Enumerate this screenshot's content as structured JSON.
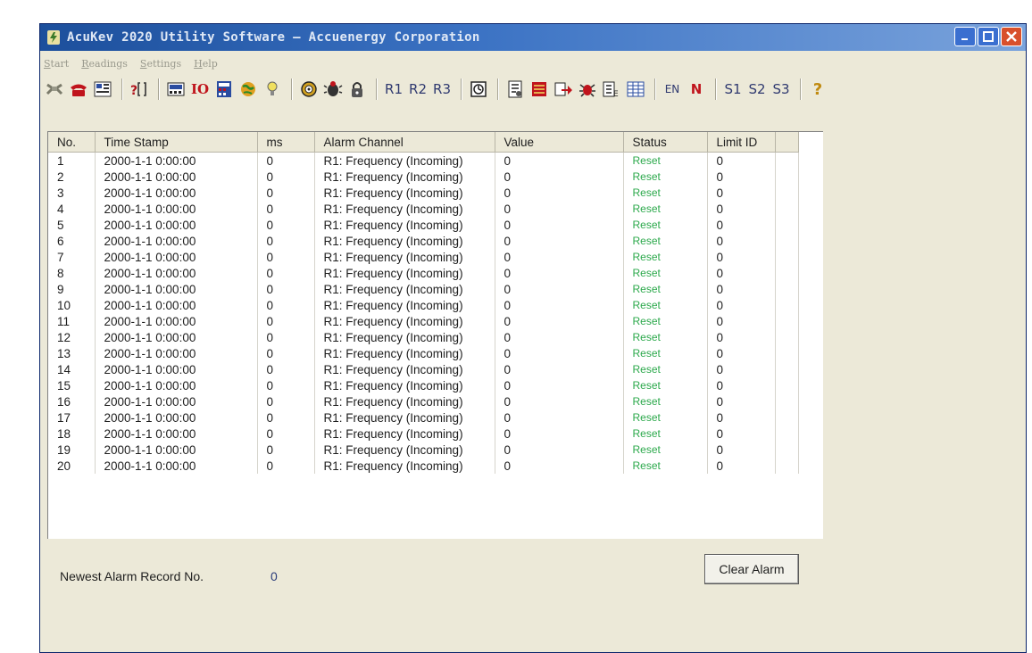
{
  "window": {
    "title": "AcuKev 2020 Utility Software — Accuenergy Corporation",
    "controls": [
      "minimize",
      "maximize",
      "close"
    ]
  },
  "menu": [
    {
      "label": "Start"
    },
    {
      "label": "Readings"
    },
    {
      "label": "Settings"
    },
    {
      "label": "Help"
    }
  ],
  "toolbar": {
    "text_buttons": {
      "r1": "R1",
      "r2": "R2",
      "r3": "R3",
      "en": "EN",
      "n": "N",
      "s1": "S1",
      "s2": "S2",
      "s3": "S3",
      "help": "?",
      "io": "IO"
    },
    "icons": [
      "connect-icon",
      "phone-icon",
      "device-list-icon",
      "query-icon",
      "meter-icon",
      "io-icon",
      "calculator-icon",
      "globe-icon",
      "light-bulb-icon",
      "disc-icon",
      "alarm-bug-icon",
      "lock-icon",
      "r1-icon",
      "r2-icon",
      "r3-icon",
      "timer-icon",
      "record-icon",
      "book-icon",
      "export-icon",
      "bug-icon",
      "eb-icon",
      "grid-icon",
      "en-icon",
      "n-icon",
      "s1-icon",
      "s2-icon",
      "s3-icon",
      "help-icon"
    ]
  },
  "table": {
    "columns": [
      "No.",
      "Time Stamp",
      "ms",
      "Alarm Channel",
      "Value",
      "Status",
      "Limit ID"
    ],
    "rows": [
      [
        "1",
        "2000-1-1 0:00:00",
        "0",
        "R1: Frequency (Incoming)",
        "0",
        "Reset",
        "0"
      ],
      [
        "2",
        "2000-1-1 0:00:00",
        "0",
        "R1: Frequency (Incoming)",
        "0",
        "Reset",
        "0"
      ],
      [
        "3",
        "2000-1-1 0:00:00",
        "0",
        "R1: Frequency (Incoming)",
        "0",
        "Reset",
        "0"
      ],
      [
        "4",
        "2000-1-1 0:00:00",
        "0",
        "R1: Frequency (Incoming)",
        "0",
        "Reset",
        "0"
      ],
      [
        "5",
        "2000-1-1 0:00:00",
        "0",
        "R1: Frequency (Incoming)",
        "0",
        "Reset",
        "0"
      ],
      [
        "6",
        "2000-1-1 0:00:00",
        "0",
        "R1: Frequency (Incoming)",
        "0",
        "Reset",
        "0"
      ],
      [
        "7",
        "2000-1-1 0:00:00",
        "0",
        "R1: Frequency (Incoming)",
        "0",
        "Reset",
        "0"
      ],
      [
        "8",
        "2000-1-1 0:00:00",
        "0",
        "R1: Frequency (Incoming)",
        "0",
        "Reset",
        "0"
      ],
      [
        "9",
        "2000-1-1 0:00:00",
        "0",
        "R1: Frequency (Incoming)",
        "0",
        "Reset",
        "0"
      ],
      [
        "10",
        "2000-1-1 0:00:00",
        "0",
        "R1: Frequency (Incoming)",
        "0",
        "Reset",
        "0"
      ],
      [
        "11",
        "2000-1-1 0:00:00",
        "0",
        "R1: Frequency (Incoming)",
        "0",
        "Reset",
        "0"
      ],
      [
        "12",
        "2000-1-1 0:00:00",
        "0",
        "R1: Frequency (Incoming)",
        "0",
        "Reset",
        "0"
      ],
      [
        "13",
        "2000-1-1 0:00:00",
        "0",
        "R1: Frequency (Incoming)",
        "0",
        "Reset",
        "0"
      ],
      [
        "14",
        "2000-1-1 0:00:00",
        "0",
        "R1: Frequency (Incoming)",
        "0",
        "Reset",
        "0"
      ],
      [
        "15",
        "2000-1-1 0:00:00",
        "0",
        "R1: Frequency (Incoming)",
        "0",
        "Reset",
        "0"
      ],
      [
        "16",
        "2000-1-1 0:00:00",
        "0",
        "R1: Frequency (Incoming)",
        "0",
        "Reset",
        "0"
      ],
      [
        "17",
        "2000-1-1 0:00:00",
        "0",
        "R1: Frequency (Incoming)",
        "0",
        "Reset",
        "0"
      ],
      [
        "18",
        "2000-1-1 0:00:00",
        "0",
        "R1: Frequency (Incoming)",
        "0",
        "Reset",
        "0"
      ],
      [
        "19",
        "2000-1-1 0:00:00",
        "0",
        "R1: Frequency (Incoming)",
        "0",
        "Reset",
        "0"
      ],
      [
        "20",
        "2000-1-1 0:00:00",
        "0",
        "R1: Frequency (Incoming)",
        "0",
        "Reset",
        "0"
      ]
    ]
  },
  "footer": {
    "newest_label": "Newest Alarm Record No.",
    "newest_value": "0",
    "clear_button": "Clear Alarm"
  },
  "colors": {
    "title_bar": "#2a5fb0",
    "window_bg": "#ece9d8",
    "status_reset": "#2aa84a",
    "close_button": "#d8502c"
  }
}
